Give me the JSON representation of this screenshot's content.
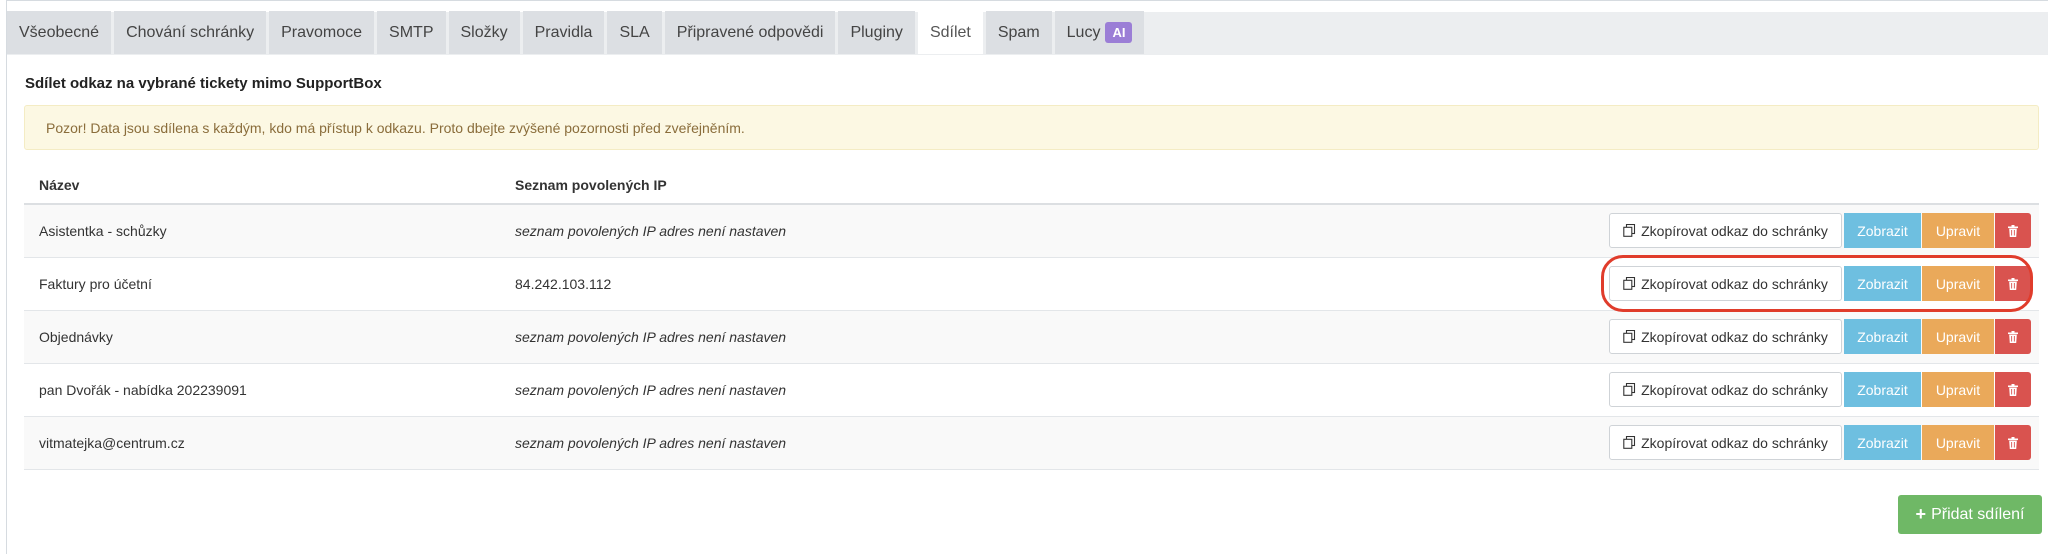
{
  "tabs": [
    {
      "label": "Všeobecné",
      "active": false
    },
    {
      "label": "Chování schránky",
      "active": false
    },
    {
      "label": "Pravomoce",
      "active": false
    },
    {
      "label": "SMTP",
      "active": false
    },
    {
      "label": "Složky",
      "active": false
    },
    {
      "label": "Pravidla",
      "active": false
    },
    {
      "label": "SLA",
      "active": false
    },
    {
      "label": "Připravené odpovědi",
      "active": false
    },
    {
      "label": "Pluginy",
      "active": false
    },
    {
      "label": "Sdílet",
      "active": true
    },
    {
      "label": "Spam",
      "active": false
    },
    {
      "label": "Lucy",
      "active": false,
      "badge": "AI"
    }
  ],
  "panel": {
    "title": "Sdílet odkaz na vybrané tickety mimo SupportBox",
    "alert": "Pozor! Data jsou sdílena s každým, kdo má přístup k odkazu. Proto dbejte zvýšené pozornosti před zveřejněním."
  },
  "table": {
    "headers": {
      "name": "Název",
      "ip": "Seznam povolených IP"
    },
    "rows": [
      {
        "name": "Asistentka - schůzky",
        "ip": "seznam povolených IP adres není nastaven",
        "ip_set": false
      },
      {
        "name": "Faktury pro účetní",
        "ip": "84.242.103.112",
        "ip_set": true
      },
      {
        "name": "Objednávky",
        "ip": "seznam povolených IP adres není nastaven",
        "ip_set": false
      },
      {
        "name": "pan Dvořák - nabídka 202239091",
        "ip": "seznam povolených IP adres není nastaven",
        "ip_set": false
      },
      {
        "name": "vitmatejka@centrum.cz",
        "ip": "seznam povolených IP adres není nastaven",
        "ip_set": false
      }
    ],
    "actions": {
      "copy_label": "Zkopírovat odkaz do schránky",
      "view_label": "Zobrazit",
      "edit_label": "Upravit",
      "delete_icon": "trash-icon"
    }
  },
  "add_button": {
    "label": "Přidat sdílení",
    "icon": "plus-icon"
  },
  "colors": {
    "view": "#6ebfe0",
    "edit": "#eaa95a",
    "delete": "#d9534f",
    "add": "#6fb866",
    "highlight": "#e03c2b",
    "alert_bg": "#fcf8e3"
  }
}
